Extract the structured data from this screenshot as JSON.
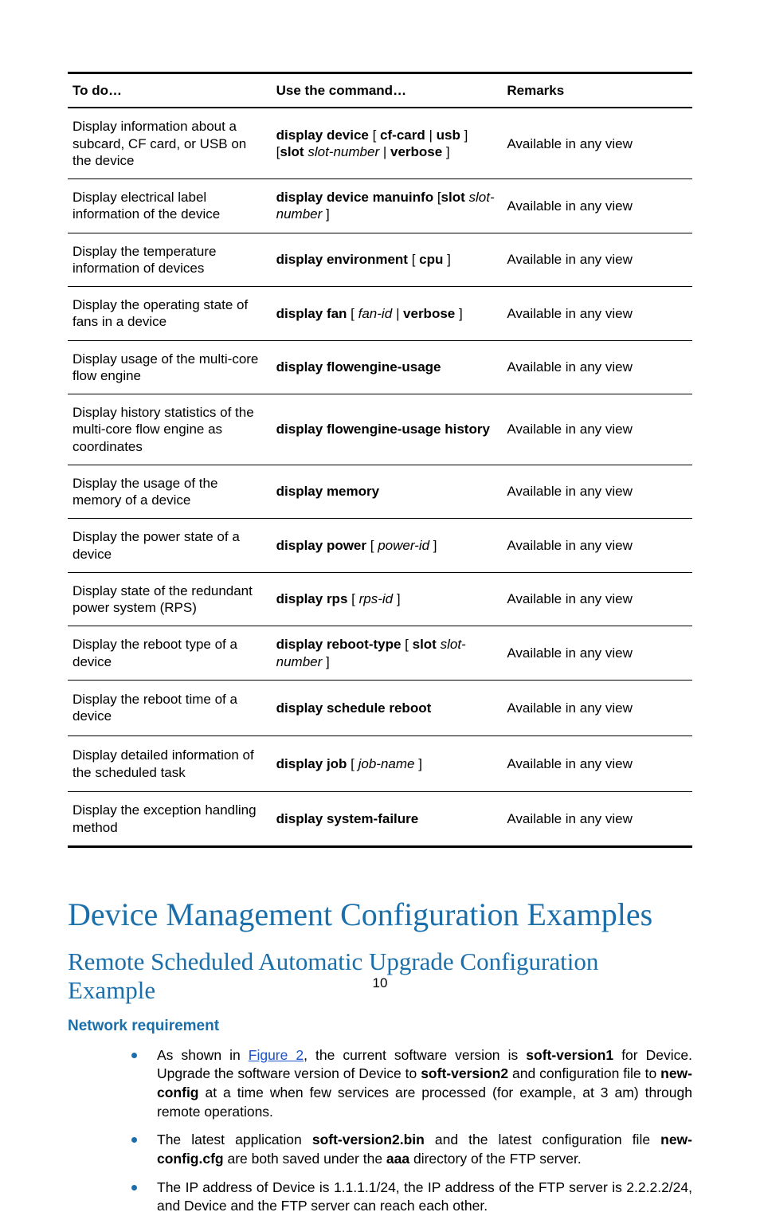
{
  "table": {
    "headers": [
      "To do…",
      "Use the command…",
      "Remarks"
    ],
    "rows": [
      {
        "todo": "Display information about a subcard, CF card, or USB on the device",
        "cmd": "<span class='bold'>display device</span> [ <span class='bold'>cf-card</span> | <span class='bold'>usb</span> ] [<span class='bold'>slot</span> <span class='ital'>slot-number</span> | <span class='bold'>verbose</span> ]",
        "remark": "Available in any view"
      },
      {
        "todo": "Display electrical label information of the device",
        "cmd": "<span class='bold'>display device manuinfo</span>  [<span class='bold'>slot</span> <span class='ital'>slot-number</span> ]",
        "remark": "Available in any view"
      },
      {
        "todo": "Display the temperature information of devices",
        "cmd": "<span class='bold'>display environment</span> [ <span class='bold'>cpu</span> ]",
        "remark": "Available in any view"
      },
      {
        "todo": "Display the operating state of fans in a device",
        "cmd": "<span class='bold'>display fan</span> [ <span class='ital'>fan-id |</span> <span class='bold'>verbose</span> ]",
        "remark": "Available in any view"
      },
      {
        "todo": "Display usage of the multi-core flow engine",
        "cmd": "<span class='bold'>display  flowengine-usage</span>",
        "remark": "Available in any view"
      },
      {
        "todo": "Display history statistics of the multi-core flow engine as coordinates",
        "cmd": "<span class='bold'>display  flowengine-usage history</span>",
        "remark": "Available in any view"
      },
      {
        "todo": "Display the usage of the memory of a device",
        "cmd": "<span class='bold'>display memory</span>",
        "remark": "Available in any view"
      },
      {
        "todo": "Display the power state of a device",
        "cmd": "<span class='bold'>display power</span> [ <span class='ital'>power-id</span> ]",
        "remark": "Available in any view"
      },
      {
        "todo": "Display state of the redundant power system (RPS)",
        "cmd": "<span class='bold'>display rps</span> [ <span class='ital'>rps-id</span> ]",
        "remark": "Available in any view"
      },
      {
        "todo": "Display the reboot type of a device",
        "cmd": "<span class='bold'>display reboot-type</span> [ <span class='bold'>slot</span> <span class='ital'>slot-number</span> ]",
        "remark": "Available in any view"
      },
      {
        "todo": "Display the reboot time of a device",
        "cmd": "<span class='bold'>display schedule reboot</span>",
        "remark": "Available in any view",
        "tall": true
      },
      {
        "todo": "Display detailed information of the scheduled task",
        "cmd": "<span class='bold'>display job</span> [ <span class='ital'>job-name</span> ]",
        "remark": "Available in any view",
        "tall": true
      },
      {
        "todo": "Display the exception handling method",
        "cmd": "<span class='bold'>display system-failure</span>",
        "remark": "Available in any view"
      }
    ]
  },
  "h1": "Device Management Configuration Examples",
  "h2": "Remote Scheduled Automatic Upgrade Configuration Example",
  "h3": "Network requirement",
  "bullets": [
    "As shown in <a class='link' href='#'>Figure 2</a>, the current software version is <span class='bold'>soft-version1</span> for Device. Upgrade the software version of Device to <span class='bold'>soft-version2</span> and configuration file to <span class='bold'>new-config</span> at a time when few services are processed (for example, at 3 am) through remote operations.",
    "The latest application <span class='bold'>soft-version2.bin</span> and the latest configuration file <span class='bold'>new-config.cfg</span> are both saved under the <span class='bold'>aaa</span> directory of the FTP server.",
    "The IP address of Device is 1.1.1.1/24, the IP address of the FTP server is 2.2.2.2/24, and Device and the FTP server can reach each other."
  ],
  "page_number": "10"
}
